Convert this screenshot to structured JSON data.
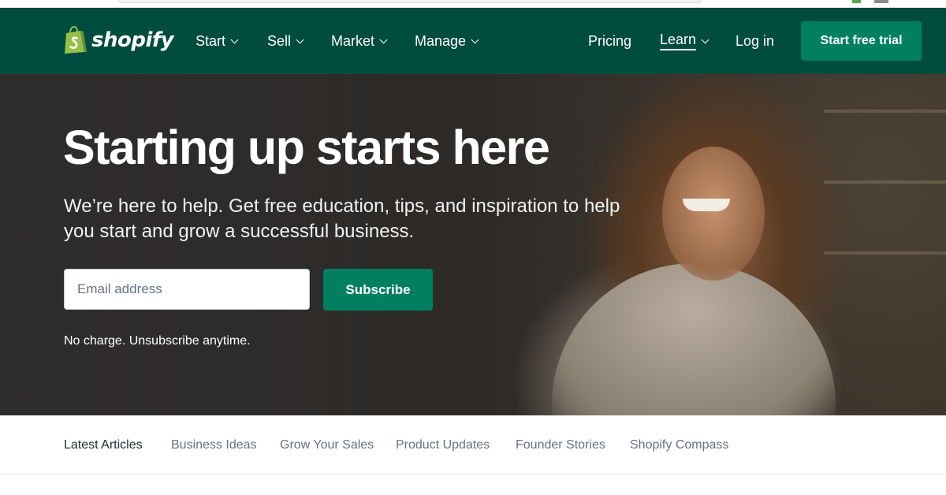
{
  "header": {
    "brand": "shopify",
    "nav_left": [
      {
        "label": "Start"
      },
      {
        "label": "Sell"
      },
      {
        "label": "Market"
      },
      {
        "label": "Manage"
      }
    ],
    "nav_right": {
      "pricing": "Pricing",
      "learn": "Learn",
      "login": "Log in",
      "cta": "Start free trial"
    }
  },
  "hero": {
    "title": "Starting up starts here",
    "subtitle": "We’re here to help. Get free education, tips, and inspiration to help you start and grow a successful business.",
    "email_placeholder": "Email address",
    "subscribe_label": "Subscribe",
    "note": "No charge. Unsubscribe anytime."
  },
  "tabs": [
    {
      "label": "Latest Articles",
      "active": true
    },
    {
      "label": "Business Ideas",
      "active": false
    },
    {
      "label": "Grow Your Sales",
      "active": false
    },
    {
      "label": "Product Updates",
      "active": false
    },
    {
      "label": "Founder Stories",
      "active": false
    },
    {
      "label": "Shopify Compass",
      "active": false
    }
  ],
  "icons": {
    "logo": "shopify-bag-icon",
    "dropdown": "chevron-down-icon"
  },
  "colors": {
    "nav_background": "#004c3f",
    "primary_button": "#008060",
    "logo_green": "#95bf47",
    "tab_active": "#212b36",
    "tab_inactive": "#637381"
  }
}
